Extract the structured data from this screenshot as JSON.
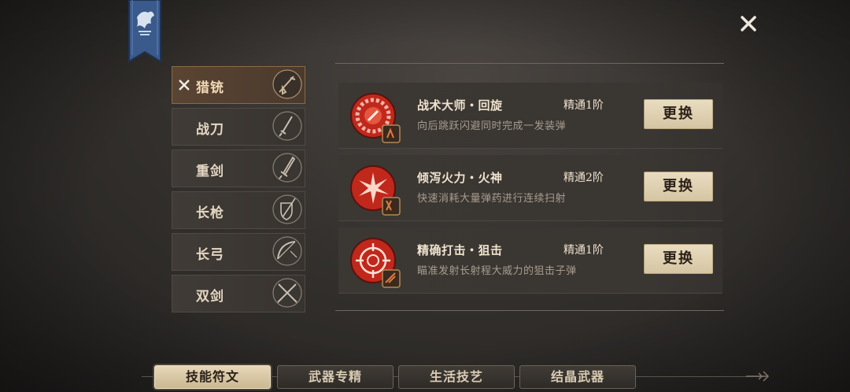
{
  "weapons": [
    {
      "label": "猎铳",
      "icon": "musket-icon",
      "active": true
    },
    {
      "label": "战刀",
      "icon": "sword-icon",
      "active": false
    },
    {
      "label": "重剑",
      "icon": "greatsword-icon",
      "active": false
    },
    {
      "label": "长枪",
      "icon": "spear-shield-icon",
      "active": false
    },
    {
      "label": "长弓",
      "icon": "longbow-icon",
      "active": false
    },
    {
      "label": "双剑",
      "icon": "dual-swords-icon",
      "active": false
    }
  ],
  "skills": [
    {
      "name": "战术大师・回旋",
      "rank": "精通1阶",
      "desc": "向后跳跃闪避同时完成一发装弹",
      "button": "更换",
      "icon": "gear-skill-icon"
    },
    {
      "name": "倾泻火力・火神",
      "rank": "精通2阶",
      "desc": "快速消耗大量弹药进行连续扫射",
      "button": "更换",
      "icon": "burst-skill-icon"
    },
    {
      "name": "精确打击・狙击",
      "rank": "精通1阶",
      "desc": "瞄准发射长射程大威力的狙击子弹",
      "button": "更换",
      "icon": "crosshair-skill-icon"
    }
  ],
  "tabs": [
    {
      "label": "技能符文",
      "active": true
    },
    {
      "label": "武器专精",
      "active": false
    },
    {
      "label": "生活技艺",
      "active": false
    },
    {
      "label": "结晶武器",
      "active": false
    }
  ],
  "colors": {
    "accent": "#d9ccaa",
    "skill_red": "#c0281c",
    "active_weapon": "#5a4433"
  }
}
